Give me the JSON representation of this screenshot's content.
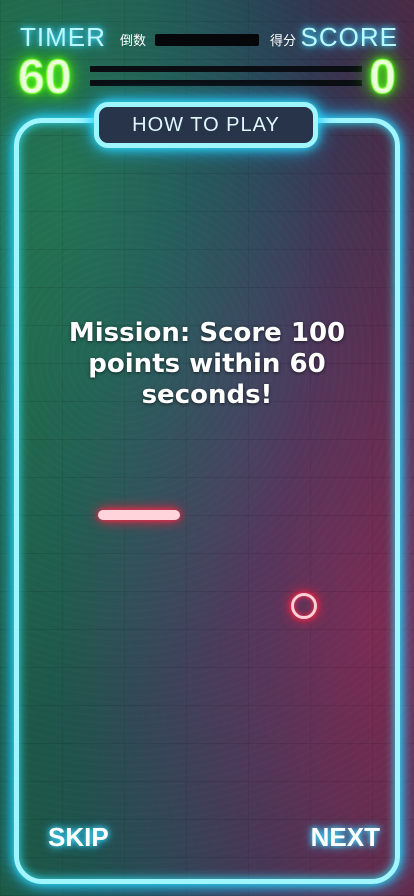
{
  "hud": {
    "timer_label": "TIMER",
    "timer_sub": "倒数",
    "timer_value": "60",
    "score_label": "SCORE",
    "score_sub": "得分",
    "score_value": "0"
  },
  "panel": {
    "title": "HOW TO PLAY",
    "mission_text": "Mission: Score 100 points within 60 seconds!"
  },
  "nav": {
    "skip_label": "SKIP",
    "next_label": "NEXT"
  },
  "colors": {
    "frame_neon": "#9ff6ff",
    "timer_score_glow": "#66ff22",
    "game_piece_neon": "#ff2a4a"
  }
}
